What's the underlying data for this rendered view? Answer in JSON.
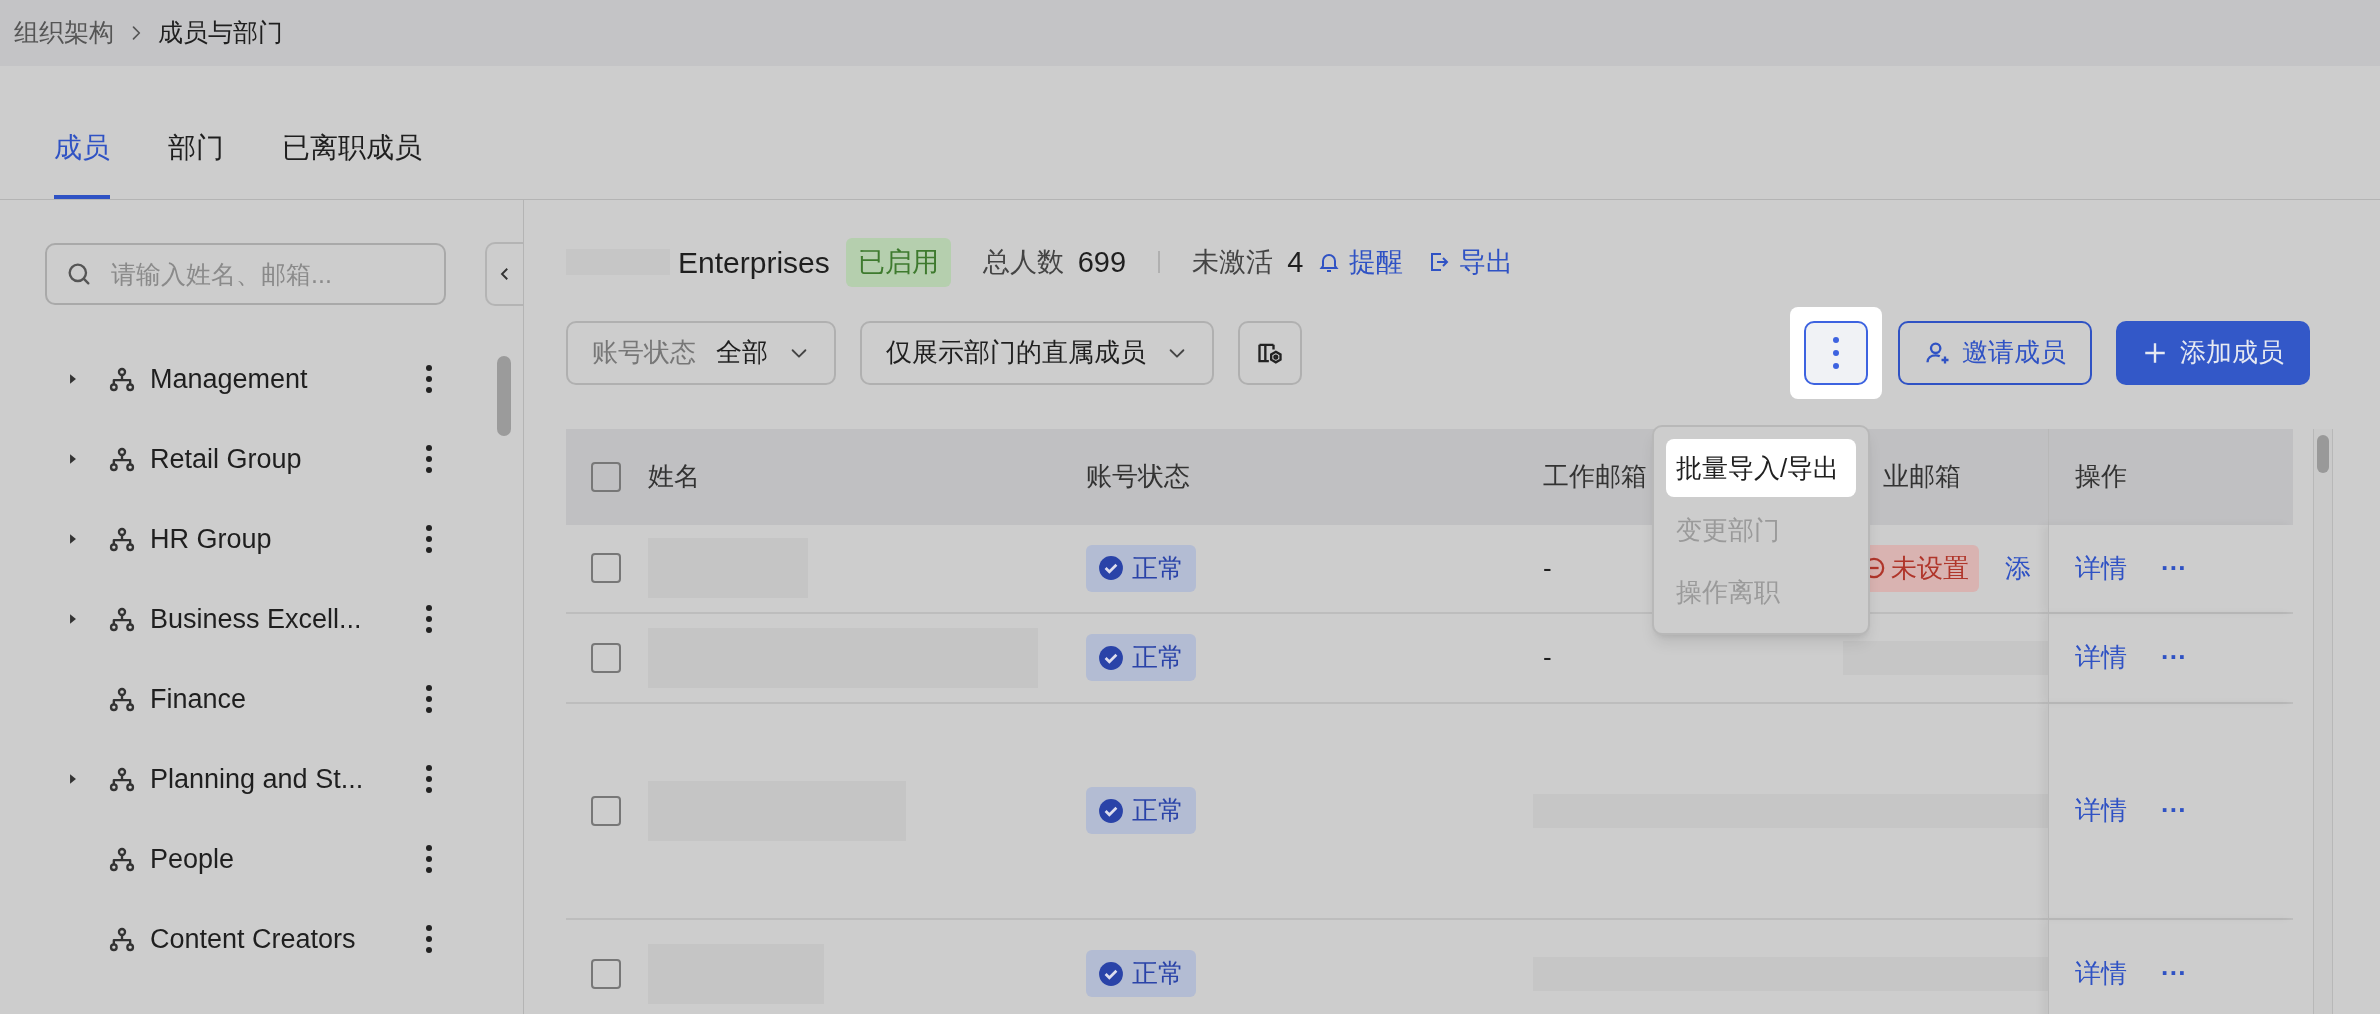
{
  "breadcrumb": [
    "组织架构",
    "成员与部门"
  ],
  "tabs": [
    {
      "label": "成员",
      "selected": true
    },
    {
      "label": "部门",
      "selected": false
    },
    {
      "label": "已离职成员",
      "selected": false
    }
  ],
  "sidebar": {
    "search": {
      "placeholder": "请输入姓名、邮箱..."
    },
    "items": [
      {
        "label": "Management",
        "expandable": true
      },
      {
        "label": "Retail Group",
        "expandable": true
      },
      {
        "label": "HR Group",
        "expandable": true
      },
      {
        "label": "Business Excell...",
        "expandable": true
      },
      {
        "label": "Finance",
        "expandable": false
      },
      {
        "label": "Planning and St...",
        "expandable": true
      },
      {
        "label": "People",
        "expandable": false
      },
      {
        "label": "Content Creators",
        "expandable": false
      }
    ]
  },
  "org": {
    "name": "Enterprises",
    "status": "已启用",
    "total_label": "总人数",
    "total": "699",
    "inactive_label": "未激活",
    "inactive": "4",
    "remind": "提醒",
    "export": "导出"
  },
  "filters": [
    {
      "label": "账号状态",
      "value": "全部"
    },
    {
      "value": "仅展示部门的直属成员"
    }
  ],
  "buttons": {
    "invite": "邀请成员",
    "add": "添加成员"
  },
  "menu": [
    {
      "label": "批量导入/导出",
      "disabled": false,
      "highlighted": true
    },
    {
      "label": "变更部门",
      "disabled": true,
      "highlighted": false
    },
    {
      "label": "操作离职",
      "disabled": true,
      "highlighted": false
    }
  ],
  "table": {
    "header_checked": false,
    "columns": [
      "姓名",
      "账号状态",
      "工作邮箱",
      "业邮箱",
      "操作"
    ],
    "rows": [
      {
        "checked": false,
        "status": "正常",
        "work_email": {
          "kind": "text",
          "text": "-"
        },
        "enterprise_email": {
          "kind": "unset",
          "text": "未设置",
          "link": "添"
        },
        "actions": [
          "详情",
          "···"
        ]
      },
      {
        "checked": false,
        "status": "正常",
        "work_email": {
          "kind": "text",
          "text": "-"
        },
        "enterprise_email": {
          "kind": "redacted"
        },
        "actions": [
          "详情",
          "···"
        ]
      },
      {
        "checked": false,
        "status": "正常",
        "work_email": {
          "kind": "redacted"
        },
        "enterprise_email": {
          "kind": "redacted"
        },
        "actions": [
          "详情",
          "···"
        ]
      },
      {
        "checked": false,
        "status": "正常",
        "work_email": {
          "kind": "redacted"
        },
        "enterprise_email": {
          "kind": "redacted"
        },
        "actions": [
          "详情",
          "···"
        ]
      }
    ]
  }
}
